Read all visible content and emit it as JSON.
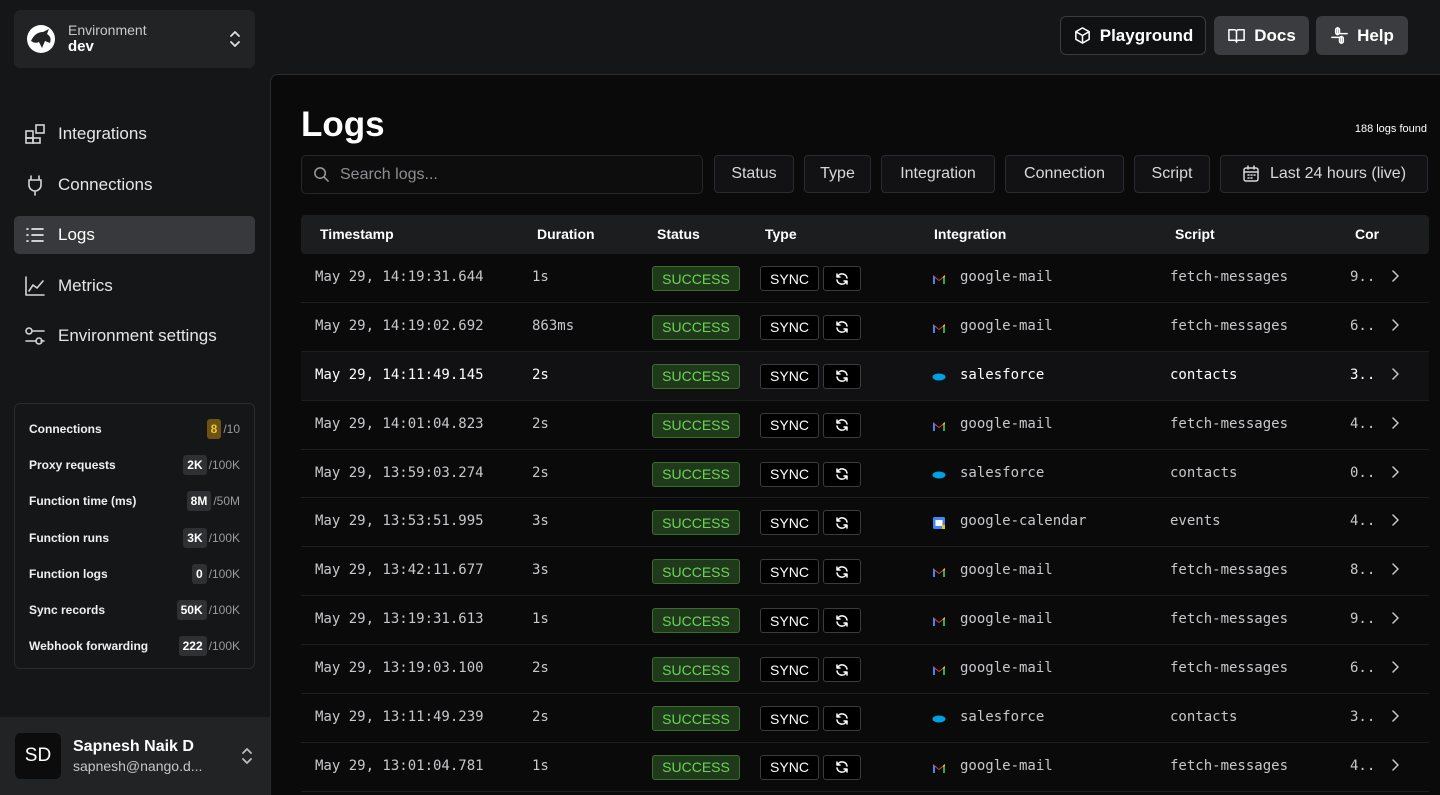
{
  "sidebar": {
    "environment_label": "Environment",
    "environment_value": "dev",
    "nav": [
      {
        "label": "Integrations",
        "icon": "integrations-icon"
      },
      {
        "label": "Connections",
        "icon": "plug-icon"
      },
      {
        "label": "Logs",
        "icon": "list-icon",
        "active": true
      },
      {
        "label": "Metrics",
        "icon": "chart-icon"
      },
      {
        "label": "Environment settings",
        "icon": "sliders-icon"
      }
    ],
    "usage": [
      {
        "label": "Connections",
        "value": "8",
        "limit": "/10"
      },
      {
        "label": "Proxy requests",
        "value": "2K",
        "limit": "/100K"
      },
      {
        "label": "Function time (ms)",
        "value": "8M",
        "limit": "/50M"
      },
      {
        "label": "Function runs",
        "value": "3K",
        "limit": "/100K"
      },
      {
        "label": "Function logs",
        "value": "0",
        "limit": "/100K"
      },
      {
        "label": "Sync records",
        "value": "50K",
        "limit": "/100K"
      },
      {
        "label": "Webhook forwarding",
        "value": "222",
        "limit": "/100K"
      }
    ],
    "user": {
      "initials": "SD",
      "name": "Sapnesh Naik D",
      "email": "sapnesh@nango.d..."
    }
  },
  "header": {
    "playground": "Playground",
    "docs": "Docs",
    "help": "Help"
  },
  "page": {
    "title": "Logs",
    "found": "188 logs found",
    "search_placeholder": "Search logs...",
    "filters": {
      "status": "Status",
      "type": "Type",
      "integration": "Integration",
      "connection": "Connection",
      "script": "Script",
      "period": "Last 24 hours (live)"
    }
  },
  "table": {
    "columns": {
      "timestamp": "Timestamp",
      "duration": "Duration",
      "status": "Status",
      "type": "Type",
      "integration": "Integration",
      "script": "Script",
      "connection": "Cor"
    },
    "rows": [
      {
        "timestamp": "May 29, 14:19:31.644",
        "duration": "1s",
        "status": "SUCCESS",
        "type": "SYNC",
        "integration": "google-mail",
        "script": "fetch-messages",
        "connection": "9..",
        "icon": "gmail"
      },
      {
        "timestamp": "May 29, 14:19:02.692",
        "duration": "863ms",
        "status": "SUCCESS",
        "type": "SYNC",
        "integration": "google-mail",
        "script": "fetch-messages",
        "connection": "6..",
        "icon": "gmail"
      },
      {
        "timestamp": "May 29, 14:11:49.145",
        "duration": "2s",
        "status": "SUCCESS",
        "type": "SYNC",
        "integration": "salesforce",
        "script": "contacts",
        "connection": "3..",
        "icon": "salesforce",
        "highlight": true
      },
      {
        "timestamp": "May 29, 14:01:04.823",
        "duration": "2s",
        "status": "SUCCESS",
        "type": "SYNC",
        "integration": "google-mail",
        "script": "fetch-messages",
        "connection": "4..",
        "icon": "gmail"
      },
      {
        "timestamp": "May 29, 13:59:03.274",
        "duration": "2s",
        "status": "SUCCESS",
        "type": "SYNC",
        "integration": "salesforce",
        "script": "contacts",
        "connection": "0..",
        "icon": "salesforce"
      },
      {
        "timestamp": "May 29, 13:53:51.995",
        "duration": "3s",
        "status": "SUCCESS",
        "type": "SYNC",
        "integration": "google-calendar",
        "script": "events",
        "connection": "4..",
        "icon": "gcal"
      },
      {
        "timestamp": "May 29, 13:42:11.677",
        "duration": "3s",
        "status": "SUCCESS",
        "type": "SYNC",
        "integration": "google-mail",
        "script": "fetch-messages",
        "connection": "8..",
        "icon": "gmail"
      },
      {
        "timestamp": "May 29, 13:19:31.613",
        "duration": "1s",
        "status": "SUCCESS",
        "type": "SYNC",
        "integration": "google-mail",
        "script": "fetch-messages",
        "connection": "9..",
        "icon": "gmail"
      },
      {
        "timestamp": "May 29, 13:19:03.100",
        "duration": "2s",
        "status": "SUCCESS",
        "type": "SYNC",
        "integration": "google-mail",
        "script": "fetch-messages",
        "connection": "6..",
        "icon": "gmail"
      },
      {
        "timestamp": "May 29, 13:11:49.239",
        "duration": "2s",
        "status": "SUCCESS",
        "type": "SYNC",
        "integration": "salesforce",
        "script": "contacts",
        "connection": "3..",
        "icon": "salesforce"
      },
      {
        "timestamp": "May 29, 13:01:04.781",
        "duration": "1s",
        "status": "SUCCESS",
        "type": "SYNC",
        "integration": "google-mail",
        "script": "fetch-messages",
        "connection": "4..",
        "icon": "gmail"
      }
    ]
  }
}
